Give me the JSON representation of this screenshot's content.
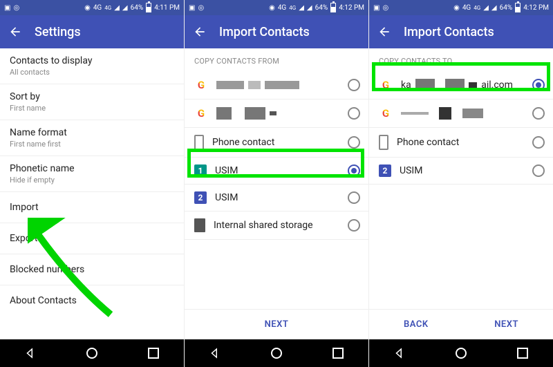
{
  "status": {
    "network": "4G",
    "hd": "4G",
    "battery": "64%",
    "time1": "4:11 PM",
    "time2": "4:12 PM",
    "time3": "4:12 PM"
  },
  "screen1": {
    "title": "Settings",
    "rows": [
      {
        "title": "Contacts to display",
        "sub": "All contacts"
      },
      {
        "title": "Sort by",
        "sub": "First name"
      },
      {
        "title": "Name format",
        "sub": "First name first"
      },
      {
        "title": "Phonetic name",
        "sub": "Hide if empty"
      },
      {
        "title": "Import"
      },
      {
        "title": "Export"
      },
      {
        "title": "Blocked numbers"
      },
      {
        "title": "About Contacts"
      }
    ]
  },
  "screen2": {
    "title": "Import Contacts",
    "section": "COPY CONTACTS FROM",
    "options": {
      "google1": "",
      "google2": "",
      "phone": "Phone contact",
      "usim1": "USIM",
      "usim2": "USIM",
      "storage": "Internal shared storage"
    },
    "next": "NEXT"
  },
  "screen3": {
    "title": "Import Contacts",
    "section": "COPY CONTACTS TO",
    "options": {
      "google1_pre": "ka",
      "google1_post": "ail.com",
      "google2": "",
      "phone": "Phone contact",
      "usim": "USIM"
    },
    "back": "BACK",
    "next": "NEXT"
  }
}
